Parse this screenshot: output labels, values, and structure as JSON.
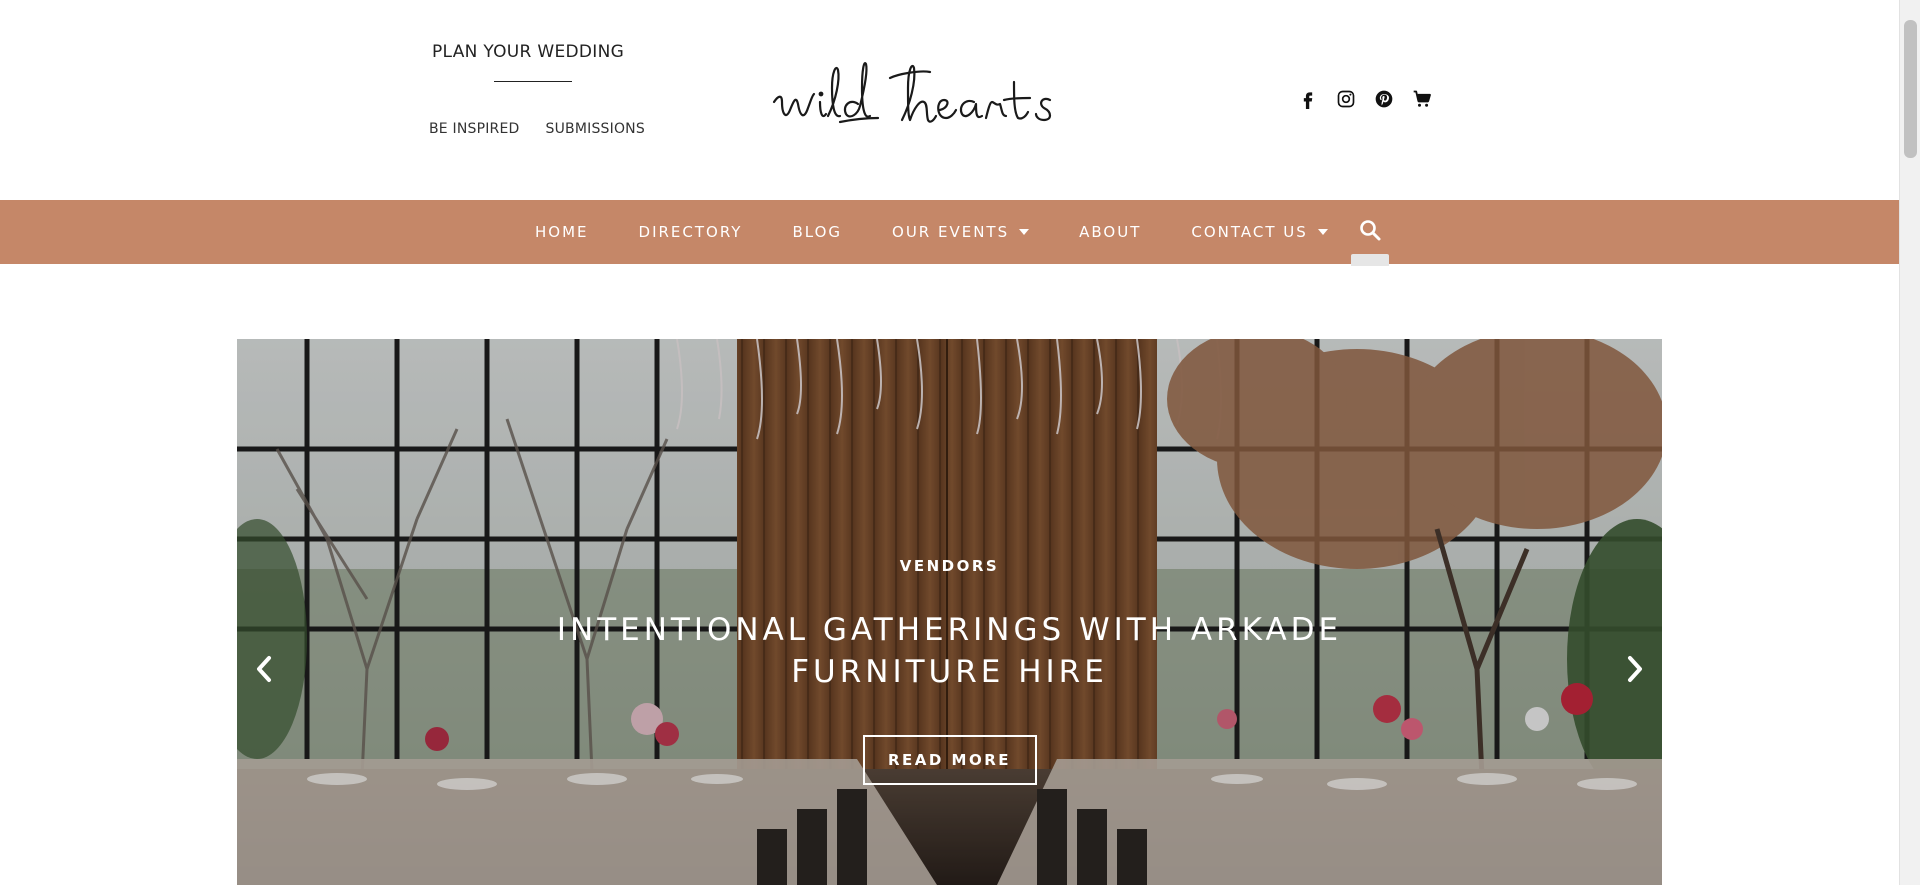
{
  "header": {
    "plan_label": "PLAN YOUR WEDDING",
    "sub_links": [
      "BE INSPIRED",
      "SUBMISSIONS"
    ],
    "logo_text": "wild hearts",
    "social_icons": [
      "facebook-icon",
      "instagram-icon",
      "pinterest-icon",
      "cart-icon"
    ]
  },
  "nav": {
    "items": [
      {
        "label": "HOME",
        "has_dropdown": false
      },
      {
        "label": "DIRECTORY",
        "has_dropdown": false
      },
      {
        "label": "BLOG",
        "has_dropdown": false
      },
      {
        "label": "OUR EVENTS",
        "has_dropdown": true
      },
      {
        "label": "ABOUT",
        "has_dropdown": false
      },
      {
        "label": "CONTACT US",
        "has_dropdown": true
      }
    ],
    "search_icon": "search-icon",
    "background": "#c58768"
  },
  "hero": {
    "category": "VENDORS",
    "title": "INTENTIONAL GATHERINGS WITH ARKADE FURNITURE HIRE",
    "button_label": "READ MORE",
    "prev_icon": "chevron-left-icon",
    "next_icon": "chevron-right-icon"
  }
}
